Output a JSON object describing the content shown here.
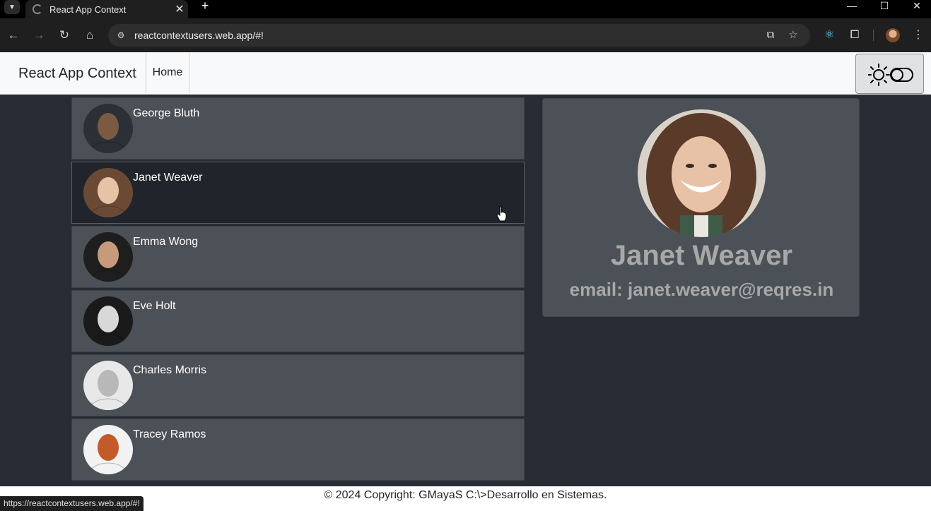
{
  "browser": {
    "tab_title": "React App Context",
    "tab_close": "✕",
    "new_tab": "+",
    "url": "reactcontextusers.web.app/#!",
    "status_url": "https://reactcontextusers.web.app/#!",
    "icons": [
      "tab-menu-icon",
      "back-icon",
      "forward-icon",
      "reload-icon",
      "home-icon",
      "site-info-icon",
      "install-app-icon",
      "bookmark-star-icon",
      "react-devtools-icon",
      "extensions-icon",
      "profile-avatar",
      "menu-kebab-icon",
      "minimize-icon",
      "maximize-icon",
      "close-window-icon"
    ]
  },
  "header": {
    "brand": "React App Context",
    "nav_home": "Home",
    "theme_toggle_icon": "sun-toggle-icon"
  },
  "users": [
    {
      "name": "George Bluth",
      "avatar_colors": [
        "#2b2f36",
        "#7a5a43"
      ]
    },
    {
      "name": "Janet Weaver",
      "avatar_colors": [
        "#6b4a35",
        "#e6c2a6"
      ],
      "active": true
    },
    {
      "name": "Emma Wong",
      "avatar_colors": [
        "#1e1e1e",
        "#c79a7c"
      ]
    },
    {
      "name": "Eve Holt",
      "avatar_colors": [
        "#1a1a1a",
        "#d8d8d8"
      ]
    },
    {
      "name": "Charles Morris",
      "avatar_colors": [
        "#e8e8e8",
        "#b8b8b8"
      ]
    },
    {
      "name": "Tracey Ramos",
      "avatar_colors": [
        "#f2f2f2",
        "#c25a2a"
      ]
    }
  ],
  "detail": {
    "name": "Janet Weaver",
    "email_text": "email: janet.weaver@reqres.in"
  },
  "footer": {
    "text": "© 2024 Copyright: GMayaS C:\\>Desarrollo en Sistemas."
  },
  "colors": {
    "page_bg": "#282c34",
    "card_bg": "#4c5057",
    "active_card_bg": "#21252b",
    "react_blue": "#61dafb"
  }
}
